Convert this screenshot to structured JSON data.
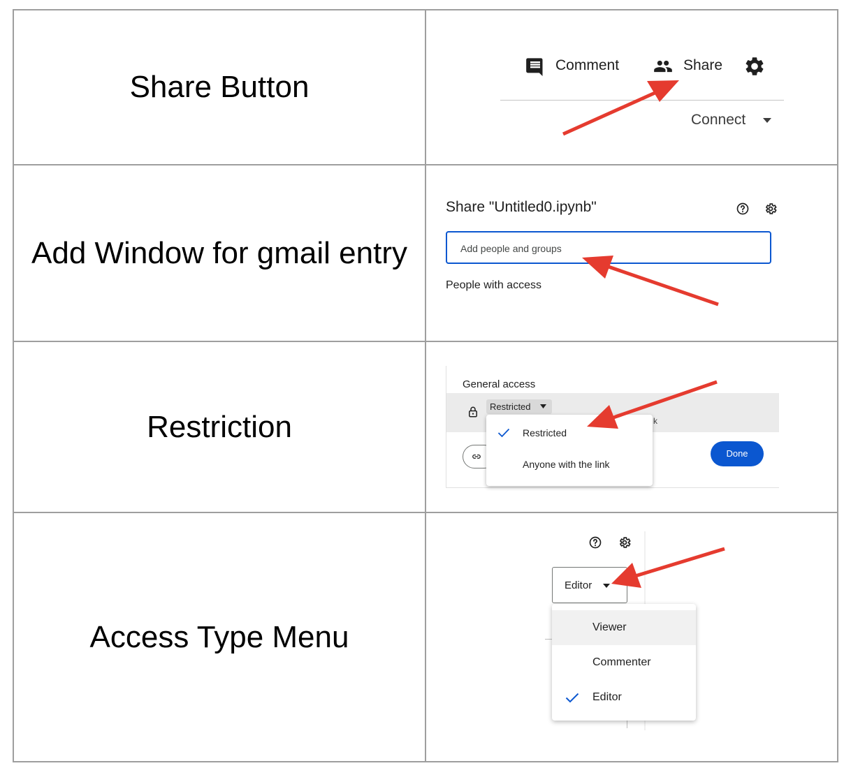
{
  "rows": [
    {
      "label": "Share Button",
      "shot": {
        "comment_label": "Comment",
        "share_label": "Share",
        "connect_label": "Connect",
        "icons": [
          "comment-icon",
          "people-icon",
          "gear-icon",
          "caret-down-icon"
        ]
      }
    },
    {
      "label": "Add Window for gmail entry",
      "shot": {
        "title": "Share \"Untitled0.ipynb\"",
        "input_placeholder": "Add people and groups",
        "people_heading": "People with access",
        "icons": [
          "help-icon",
          "gear-icon"
        ]
      }
    },
    {
      "label": "Restriction",
      "shot": {
        "heading": "General access",
        "dropdown_value": "Restricted",
        "partial_text": "k",
        "options": [
          "Restricted",
          "Anyone with the link"
        ],
        "selected_option": "Restricted",
        "done_label": "Done",
        "icons": [
          "lock-icon",
          "link-icon",
          "check-icon",
          "caret-down-icon"
        ]
      }
    },
    {
      "label": "Access Type Menu",
      "shot": {
        "dropdown_value": "Editor",
        "options": [
          "Viewer",
          "Commenter",
          "Editor"
        ],
        "selected_option": "Editor",
        "icons": [
          "help-icon",
          "gear-icon",
          "check-icon",
          "caret-down-icon"
        ]
      }
    }
  ],
  "colors": {
    "arrow": "#e53b2f",
    "accent_blue": "#0b57d0",
    "highlight_row": "#ebebeb",
    "grid_border": "#9e9e9e"
  }
}
